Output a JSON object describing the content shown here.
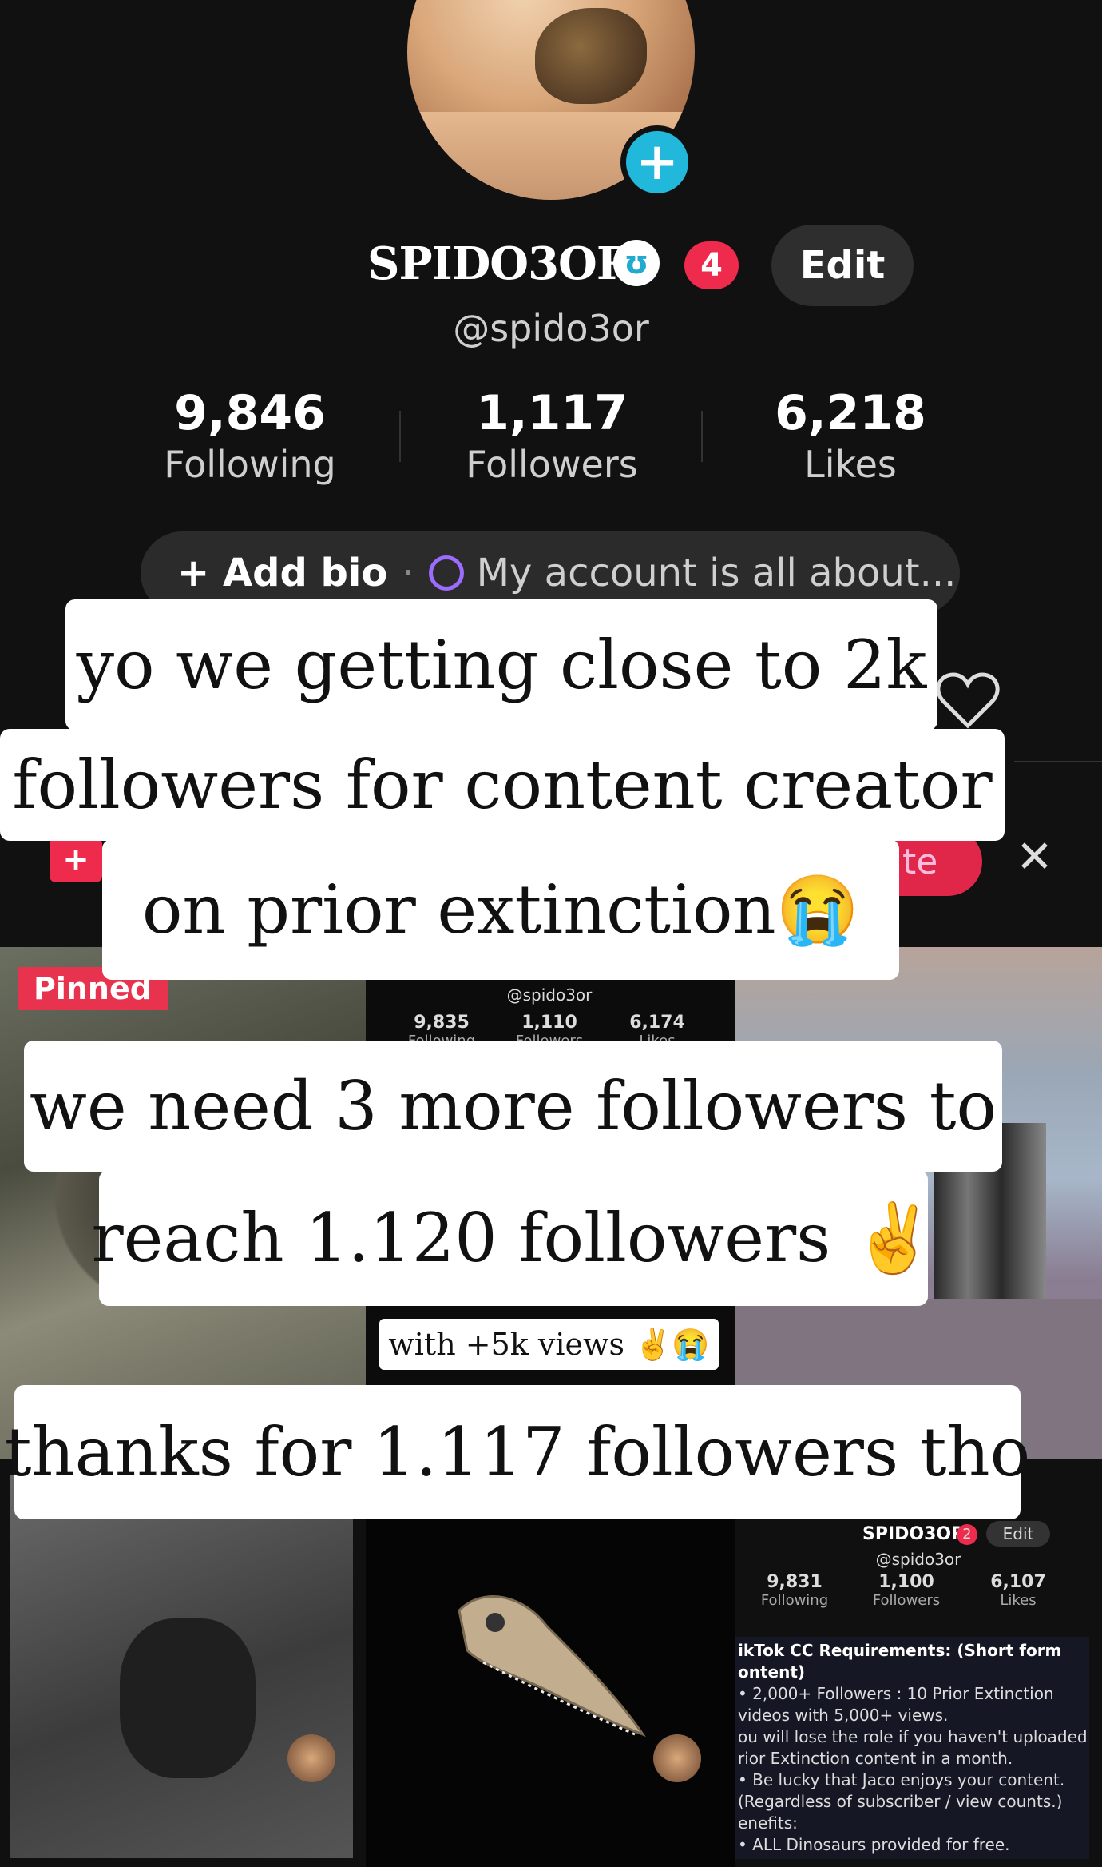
{
  "profile": {
    "username": "SPIDO3OR",
    "handle": "@spido3or",
    "notification_count": "4",
    "edit_label": "Edit",
    "stats": [
      {
        "value": "9,846",
        "label": "Following"
      },
      {
        "value": "1,117",
        "label": "Followers"
      },
      {
        "value": "6,218",
        "label": "Likes"
      }
    ],
    "bio": {
      "add_label": "Add bio",
      "placeholder": "My account is all about..."
    },
    "partial_button_text": "te"
  },
  "grid": {
    "pinned_label": "Pinned",
    "tile2": {
      "handle": "@spido3or",
      "stats": [
        {
          "value": "9,835",
          "label": "Following"
        },
        {
          "value": "1,110",
          "label": "Followers"
        },
        {
          "value": "6,174",
          "label": "Likes"
        }
      ],
      "caption": "with +5k  views ✌️😭"
    },
    "tile6": {
      "username": "SPIDO3OR",
      "notification_count": "2",
      "edit_label": "Edit",
      "handle": "@spido3or",
      "stats": [
        {
          "value": "9,831",
          "label": "Following"
        },
        {
          "value": "1,100",
          "label": "Followers"
        },
        {
          "value": "6,107",
          "label": "Likes"
        }
      ],
      "req_title": "ikTok  CC Requirements: (Short form",
      "req_title2": "ontent)",
      "req_lines": [
        "• 2,000+ Followers : 10 Prior Extinction",
        "videos with 5,000+ views.",
        "ou will lose the role if you haven't uploaded",
        "rior Extinction content in a month.",
        "• Be lucky that Jaco enjoys your content.",
        "(Regardless of subscriber / view counts.)",
        "enefits:",
        "• ALL Dinosaurs provided for free."
      ]
    }
  },
  "captions": {
    "line1": "yo we getting close to 2k",
    "line2": "followers for content creator",
    "line3": "on prior extinction😭",
    "line4": "we need 3 more followers to",
    "line5": "reach 1.120 followers ✌️",
    "line6": "thanks for 1.117 followers tho"
  },
  "colors": {
    "accent_pink": "#ee2b4c",
    "accent_cyan": "#22b8dc",
    "background": "#111111"
  }
}
